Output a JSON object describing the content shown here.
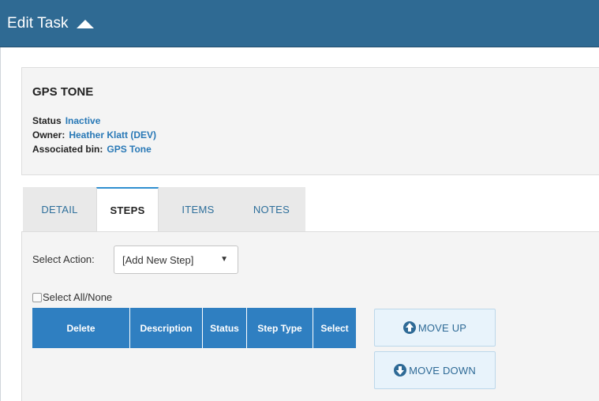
{
  "header": {
    "title": "Edit Task"
  },
  "task": {
    "name": "GPS TONE",
    "status_label": "Status",
    "status_value": "Inactive",
    "owner_label": "Owner:",
    "owner_value": "Heather Klatt (DEV)",
    "bin_label": "Associated bin:",
    "bin_value": "GPS Tone"
  },
  "tabs": [
    {
      "label": "DETAIL",
      "active": false
    },
    {
      "label": "STEPS",
      "active": true
    },
    {
      "label": "ITEMS",
      "active": false
    },
    {
      "label": "NOTES",
      "active": false
    }
  ],
  "steps": {
    "select_action_label": "Select Action:",
    "select_action_value": "[Add New Step]",
    "select_all_label": "Select All/None",
    "select_all_checked": false,
    "columns": [
      "Delete",
      "Description",
      "Status",
      "Step Type",
      "Select"
    ],
    "rows": [],
    "move_up_label": "MOVE UP",
    "move_down_label": "MOVE DOWN"
  },
  "colors": {
    "header_bg": "#2f6a93",
    "link": "#2878b6",
    "grid_header_bg": "#2f7fc1",
    "active_tab_border": "#2f8fd0",
    "button_bg": "#e8f3fb"
  },
  "icons": {
    "header_toggle": "caret-up-icon",
    "move_up": "arrow-circle-up-icon",
    "move_down": "arrow-circle-down-icon",
    "select_dropdown": "caret-down-icon"
  }
}
